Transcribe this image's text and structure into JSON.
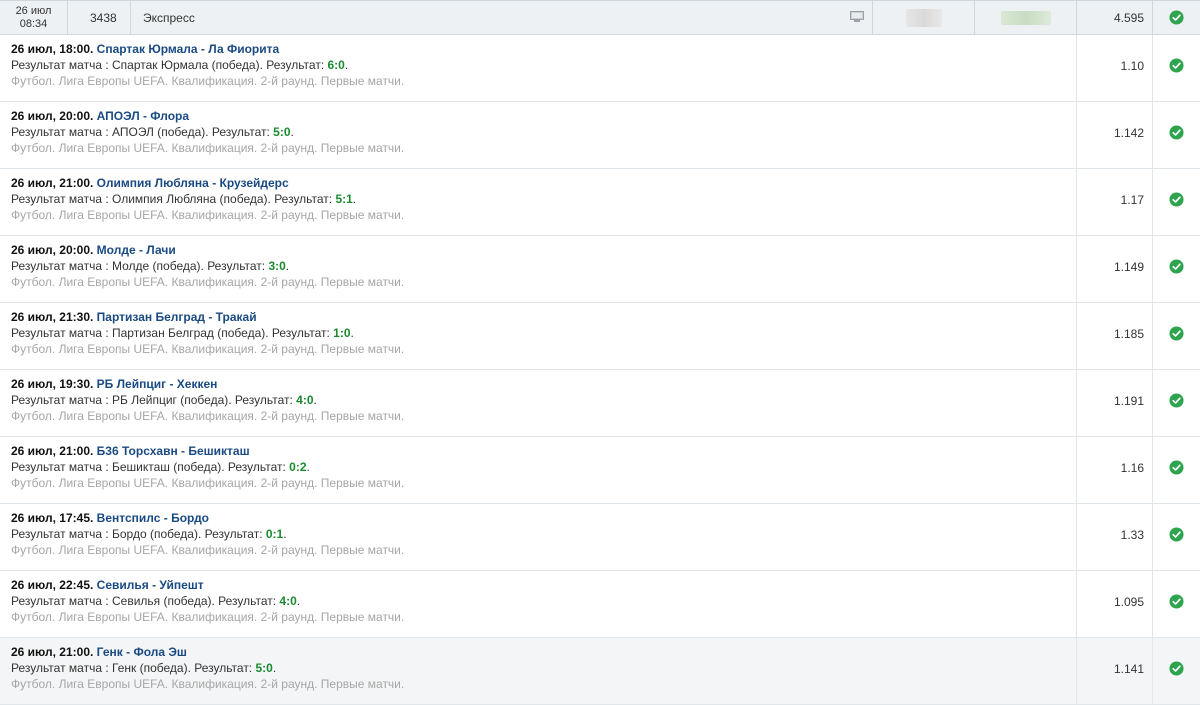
{
  "header": {
    "date": "26 июл",
    "time": "08:34",
    "number": "3438",
    "bet_type": "Экспресс",
    "coefficient": "4.595",
    "status_icon": "check-circle-icon",
    "status_color": "#2ea44f"
  },
  "rows": [
    {
      "datetime": "26 июл, 18:00.",
      "match": "Спартак Юрмала - Ла Фиорита",
      "result_prefix": "Результат матча : ",
      "result_outcome": "Спартак Юрмала (победа). Результат: ",
      "score": "6:0",
      "score_suffix": ".",
      "league": "Футбол. Лига Европы UEFA. Квалификация. 2-й раунд. Первые матчи.",
      "coef": "1.10"
    },
    {
      "datetime": "26 июл, 20:00.",
      "match": "АПОЭЛ - Флора",
      "result_prefix": "Результат матча : ",
      "result_outcome": "АПОЭЛ (победа). Результат: ",
      "score": "5:0",
      "score_suffix": ".",
      "league": "Футбол. Лига Европы UEFA. Квалификация. 2-й раунд. Первые матчи.",
      "coef": "1.142"
    },
    {
      "datetime": "26 июл, 21:00.",
      "match": "Олимпия Любляна - Крузейдерс",
      "result_prefix": "Результат матча : ",
      "result_outcome": "Олимпия Любляна (победа). Результат: ",
      "score": "5:1",
      "score_suffix": ".",
      "league": "Футбол. Лига Европы UEFA. Квалификация. 2-й раунд. Первые матчи.",
      "coef": "1.17"
    },
    {
      "datetime": "26 июл, 20:00.",
      "match": "Молде - Лачи",
      "result_prefix": "Результат матча : ",
      "result_outcome": "Молде (победа). Результат: ",
      "score": "3:0",
      "score_suffix": ".",
      "league": "Футбол. Лига Европы UEFA. Квалификация. 2-й раунд. Первые матчи.",
      "coef": "1.149"
    },
    {
      "datetime": "26 июл, 21:30.",
      "match": "Партизан Белград - Тракай",
      "result_prefix": "Результат матча : ",
      "result_outcome": "Партизан Белград (победа). Результат: ",
      "score": "1:0",
      "score_suffix": ".",
      "league": "Футбол. Лига Европы UEFA. Квалификация. 2-й раунд. Первые матчи.",
      "coef": "1.185"
    },
    {
      "datetime": "26 июл, 19:30.",
      "match": "РБ Лейпциг - Хеккен",
      "result_prefix": "Результат матча : ",
      "result_outcome": "РБ Лейпциг (победа). Результат: ",
      "score": "4:0",
      "score_suffix": ".",
      "league": "Футбол. Лига Европы UEFA. Квалификация. 2-й раунд. Первые матчи.",
      "coef": "1.191"
    },
    {
      "datetime": "26 июл, 21:00.",
      "match": "Б36 Торсхавн - Бешикташ",
      "result_prefix": "Результат матча : ",
      "result_outcome": "Бешикташ (победа). Результат: ",
      "score": "0:2",
      "score_suffix": ".",
      "league": "Футбол. Лига Европы UEFA. Квалификация. 2-й раунд. Первые матчи.",
      "coef": "1.16"
    },
    {
      "datetime": "26 июл, 17:45.",
      "match": "Вентспилс - Бордо",
      "result_prefix": "Результат матча : ",
      "result_outcome": "Бордо (победа). Результат: ",
      "score": "0:1",
      "score_suffix": ".",
      "league": "Футбол. Лига Европы UEFA. Квалификация. 2-й раунд. Первые матчи.",
      "coef": "1.33"
    },
    {
      "datetime": "26 июл, 22:45.",
      "match": "Севилья - Уйпешт",
      "result_prefix": "Результат матча : ",
      "result_outcome": "Севилья (победа). Результат: ",
      "score": "4:0",
      "score_suffix": ".",
      "league": "Футбол. Лига Европы UEFA. Квалификация. 2-й раунд. Первые матчи.",
      "coef": "1.095"
    },
    {
      "datetime": "26 июл, 21:00.",
      "match": "Генк - Фола Эш",
      "result_prefix": "Результат матча : ",
      "result_outcome": "Генк (победа). Результат: ",
      "score": "5:0",
      "score_suffix": ".",
      "league": "Футбол. Лига Европы UEFA. Квалификация. 2-й раунд. Первые матчи.",
      "coef": "1.141"
    }
  ]
}
